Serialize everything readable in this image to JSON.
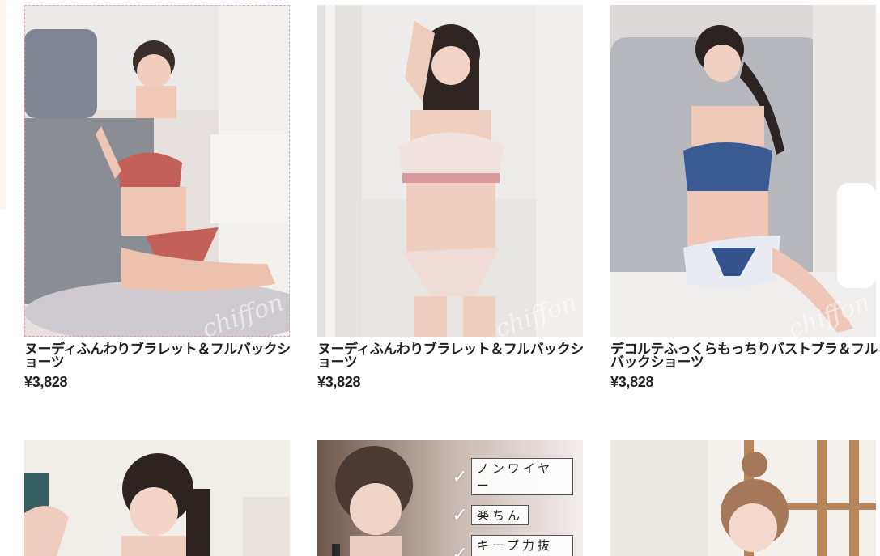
{
  "products": [
    {
      "title": "ヌーディふんわりブラレット＆フルバックショーツ",
      "price": "¥3,828",
      "watermark": "chiffon",
      "colors": {
        "bg": "#e9e4e2",
        "wear": "#c4605a"
      }
    },
    {
      "title": "ヌーディふんわりブラレット＆フルバックショーツ",
      "price": "¥3,828",
      "watermark": "chiffon",
      "colors": {
        "bg": "#eeedea",
        "wear": "#f0dedb"
      }
    },
    {
      "title": "デコルテふっくらもっちりバストブラ＆フルバックショーツ",
      "price": "¥3,828",
      "watermark": "chiffon",
      "colors": {
        "bg": "#ddd9d8",
        "wear": "#2f4f8a"
      }
    },
    {
      "colors": {
        "bg": "#f1ede9"
      }
    },
    {
      "checklist": [
        "ノンワイヤー",
        "楽ちん",
        "キープ力抜群"
      ],
      "colors": {
        "bg": "#7a6257"
      }
    },
    {
      "colors": {
        "bg": "#f4f1ec"
      }
    }
  ]
}
